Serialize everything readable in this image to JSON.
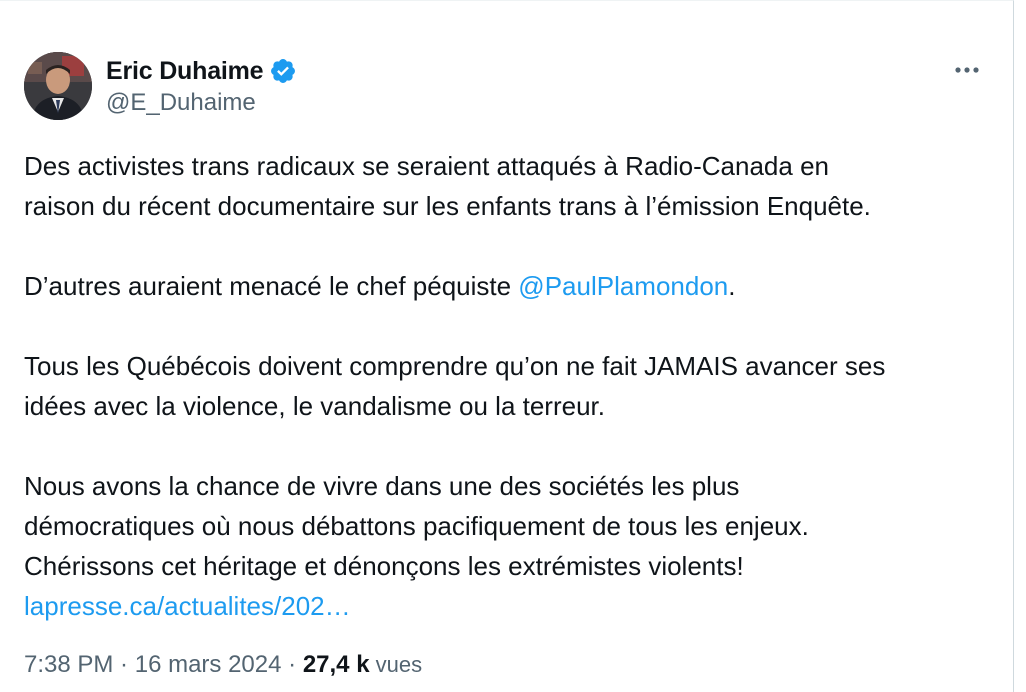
{
  "author": {
    "display_name": "Eric Duhaime",
    "handle": "@E_Duhaime",
    "verified": true,
    "verified_color": "#1d9bf0"
  },
  "tweet": {
    "para1_line1": "Des activistes trans radicaux se seraient attaqués à Radio-Canada en",
    "para1_line2": "raison du récent documentaire sur les enfants trans à l’émission Enquête.",
    "para2_before": "D’autres auraient menacé le chef péquiste ",
    "para2_mention": "@PaulPlamondon",
    "para2_after": ".",
    "para3_line1": "Tous les Québécois doivent comprendre qu’on ne fait JAMAIS avancer ses",
    "para3_line2": "idées avec la violence, le vandalisme ou la terreur.",
    "para4_line1": "Nous avons la chance de vivre dans une des sociétés les plus",
    "para4_line2": "démocratiques où nous débattons pacifiquement de tous les enjeux.",
    "para4_line3": "Chérissons cet héritage et dénonçons les extrémistes violents!",
    "link_text": "lapresse.ca/actualites/202…"
  },
  "meta": {
    "time": "7:38 PM",
    "separator1": " · ",
    "date": "16 mars 2024",
    "separator2": " · ",
    "views_count": "27,4 k",
    "views_label": " vues"
  },
  "colors": {
    "text": "#0f1419",
    "secondary": "#536471",
    "accent": "#1d9bf0"
  },
  "icons": {
    "verified": "verified-badge-icon",
    "more": "more-horizontal-icon"
  }
}
